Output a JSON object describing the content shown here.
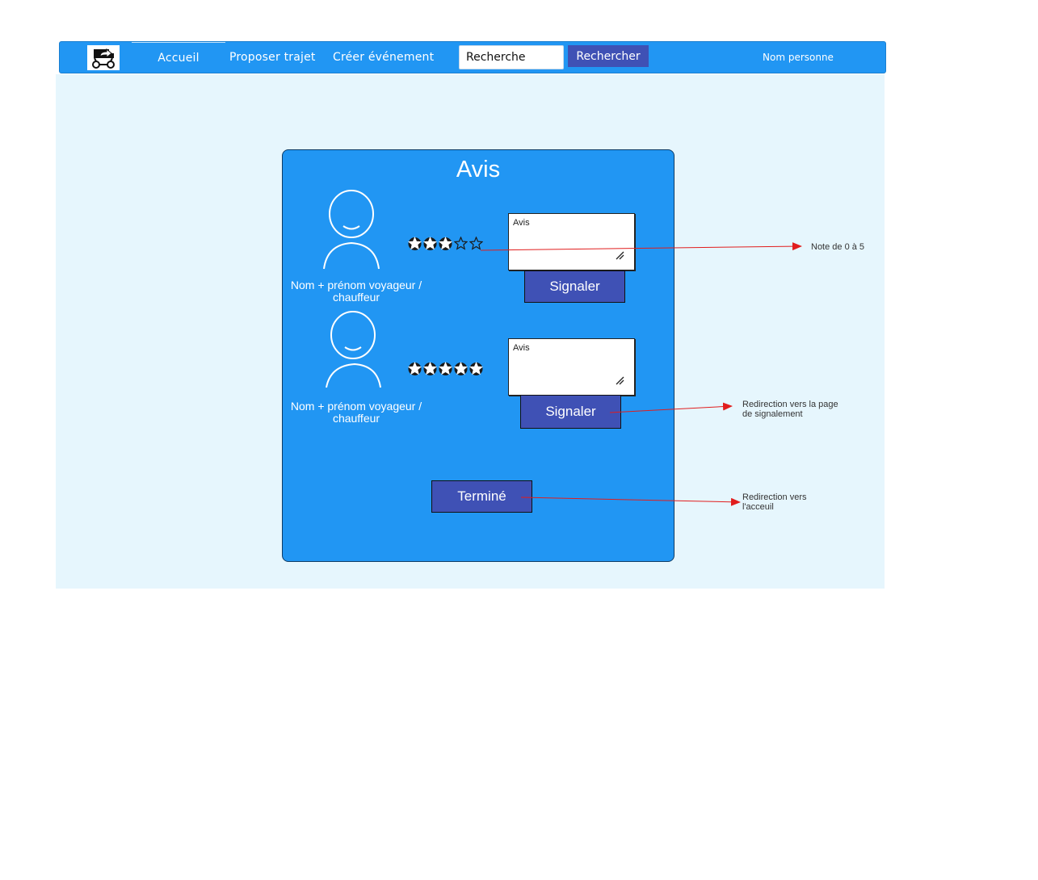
{
  "navbar": {
    "logo_icon": "car-share-icon",
    "home_label": "Accueil",
    "propose_label": "Proposer trajet",
    "event_label": "Créer événement",
    "search_value": "Recherche",
    "search_button_label": "Rechercher",
    "user_name": "Nom personne",
    "background_color": "#2196f3",
    "button_color": "#3f51b5"
  },
  "card": {
    "title": "Avis",
    "background_color": "#2196f3",
    "reviews": [
      {
        "person_name_line1": "Nom + prénom  voyageur /",
        "person_name_line2": "chauffeur",
        "rating_filled": 3,
        "rating_max": 5,
        "review_label": "Avis",
        "report_label": "Signaler"
      },
      {
        "person_name_line1": "Nom + prénom  voyageur /",
        "person_name_line2": "chauffeur",
        "rating_filled": 5,
        "rating_max": 5,
        "review_label": "Avis",
        "report_label": "Signaler"
      }
    ],
    "done_label": "Terminé"
  },
  "annotations": {
    "rating_note": "Note de 0 à 5",
    "report_note_line1": "Redirection vers la page",
    "report_note_line2": "de signalement",
    "done_note_line1": "Redirection vers",
    "done_note_line2": "l'acceuil",
    "arrow_color": "#e11d1d"
  }
}
